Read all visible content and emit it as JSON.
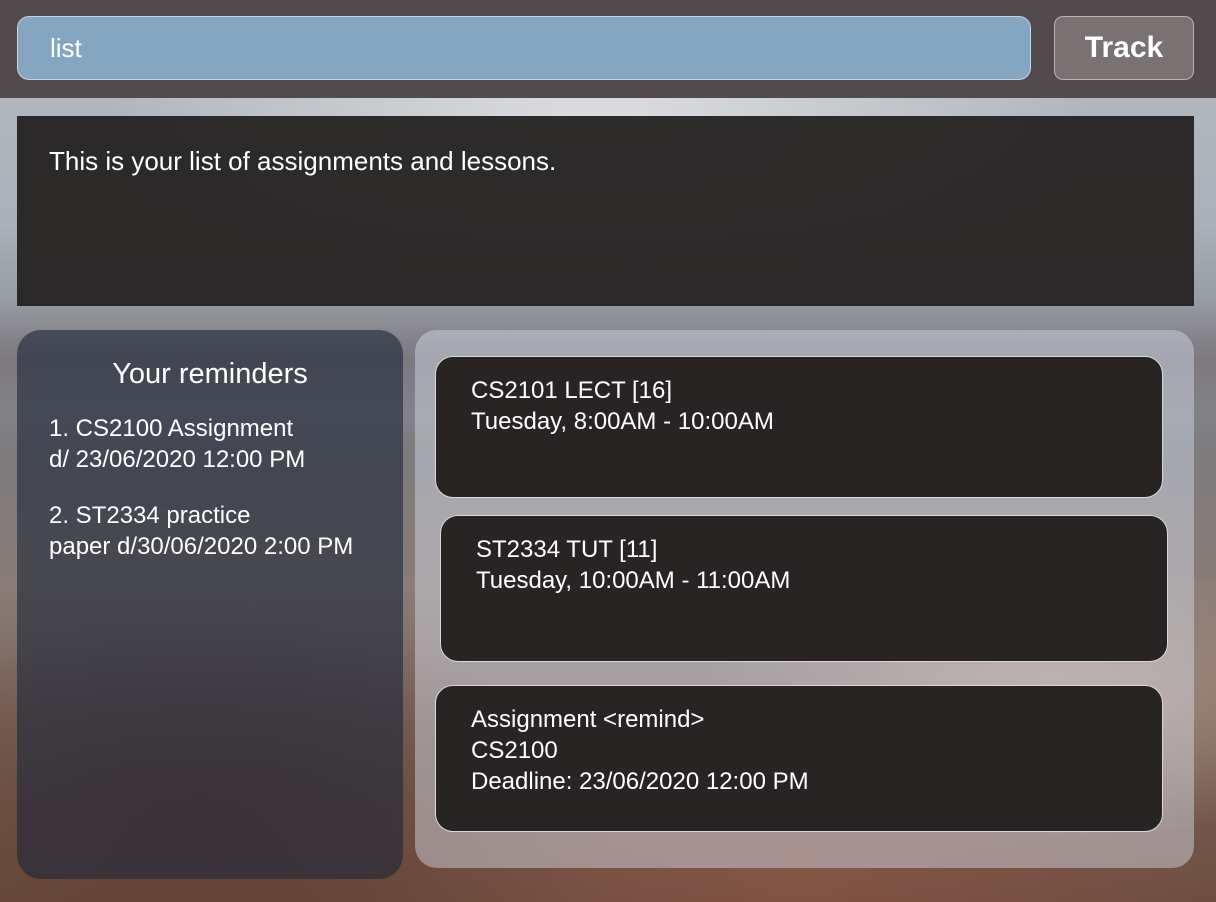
{
  "command_box": {
    "value": "list"
  },
  "track_button": {
    "label": "Track"
  },
  "result_display": {
    "text": "This is your list of assignments and lessons."
  },
  "reminders": {
    "title": "Your reminders",
    "items": [
      {
        "line1": "1. CS2100 Assignment",
        "line2": "d/ 23/06/2020 12:00 PM"
      },
      {
        "line1": "2. ST2334 practice",
        "line2": "paper d/30/06/2020 2:00 PM"
      }
    ]
  },
  "lessons": [
    {
      "line1": "CS2101 LECT [16]",
      "line2": "Tuesday, 8:00AM - 10:00AM"
    },
    {
      "line1": "ST2334 TUT [11]",
      "line2": "Tuesday, 10:00AM - 11:00AM"
    },
    {
      "line1": "Assignment <remind>",
      "line2": "CS2100",
      "line3": "Deadline: 23/06/2020 12:00 PM"
    }
  ],
  "colors": {
    "top_bar": "#524a4c",
    "command_box": "#84a6c1",
    "track_button": "#7a7272",
    "card_background": "#282424",
    "result_background": "#262323"
  }
}
